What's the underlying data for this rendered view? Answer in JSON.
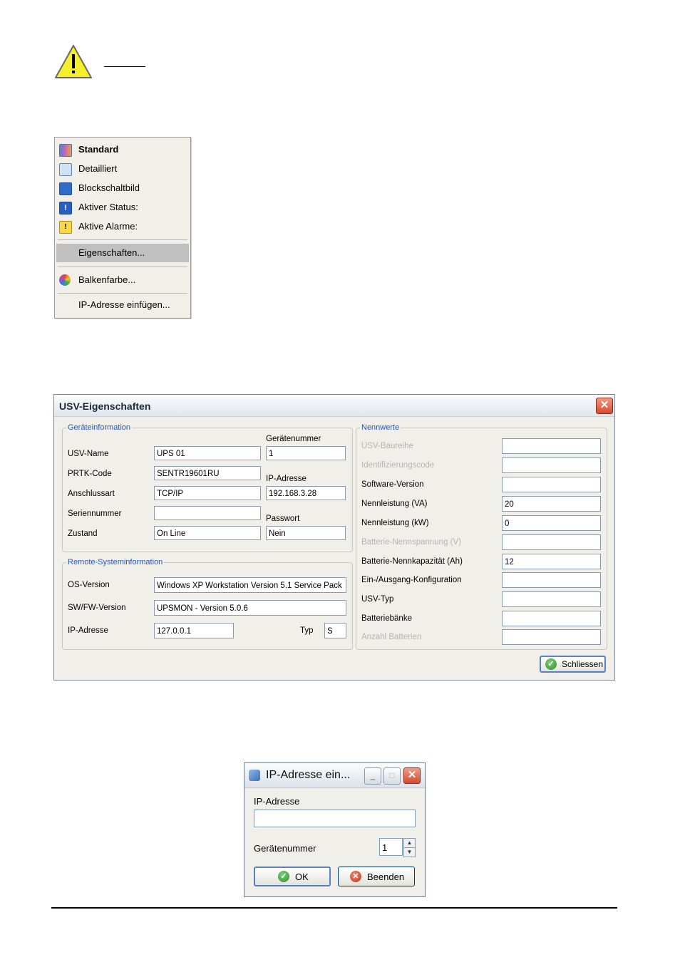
{
  "context_menu": {
    "items": [
      {
        "label": "Standard",
        "icon": "standard-view-icon"
      },
      {
        "label": "Detailliert",
        "icon": "magnifier-icon"
      },
      {
        "label": "Blockschaltbild",
        "icon": "block-diagram-icon"
      },
      {
        "label": "Aktiver Status:",
        "icon": "info-icon"
      },
      {
        "label": "Aktive Alarme:",
        "icon": "warning-icon"
      },
      {
        "label": "Eigenschaften..."
      },
      {
        "label": "Balkenfarbe...",
        "icon": "color-palette-icon"
      },
      {
        "label": "IP-Adresse einfügen..."
      }
    ],
    "selected": "Eigenschaften..."
  },
  "props_dialog": {
    "title": "USV-Eigenschaften",
    "device_group": {
      "title": "Geräteinformation",
      "usv_name_label": "USV-Name",
      "usv_name_value": "UPS 01",
      "prtk_label": "PRTK-Code",
      "prtk_value": "SENTR19601RU",
      "connection_label": "Anschlussart",
      "connection_value": "TCP/IP",
      "serial_label": "Seriennummer",
      "serial_value": "",
      "state_label": "Zustand",
      "state_value": "On Line",
      "device_no_label": "Gerätenummer",
      "device_no_value": "1",
      "ip_label": "IP-Adresse",
      "ip_value": "192.168.3.28",
      "password_label": "Passwort",
      "password_value": "Nein"
    },
    "remote_group": {
      "title": "Remote-Systeminformation",
      "os_label": "OS-Version",
      "os_value": "Windows XP Workstation Version 5.1 Service Pack",
      "fw_label": "SW/FW-Version",
      "fw_value": "UPSMON - Version 5.0.6",
      "ip_label": "IP-Adresse",
      "ip_value": "127.0.0.1",
      "type_label": "Typ",
      "type_value": "S"
    },
    "rating_group": {
      "title": "Nennwerte",
      "rows": [
        {
          "label": "USV-Baureihe",
          "value": "",
          "disabled": true
        },
        {
          "label": "Identifizierungscode",
          "value": "",
          "disabled": true
        },
        {
          "label": "Software-Version",
          "value": "",
          "disabled": false
        },
        {
          "label": "Nennleistung (VA)",
          "value": "20",
          "disabled": false
        },
        {
          "label": "Nennleistung (kW)",
          "value": "0",
          "disabled": false
        },
        {
          "label": "Batterie-Nennspannung (V)",
          "value": "",
          "disabled": true
        },
        {
          "label": "Batterie-Nennkapazität (Ah)",
          "value": "12",
          "disabled": false
        },
        {
          "label": "Ein-/Ausgang-Konfiguration",
          "value": "",
          "disabled": false
        },
        {
          "label": "USV-Typ",
          "value": "",
          "disabled": false
        },
        {
          "label": "Batteriebänke",
          "value": "",
          "disabled": false
        },
        {
          "label": "Anzahl Batterien",
          "value": "",
          "disabled": true
        }
      ]
    },
    "close_label": "Schliessen"
  },
  "ip_dialog": {
    "title": "IP-Adresse ein...",
    "ip_label": "IP-Adresse",
    "ip_value": "",
    "device_no_label": "Gerätenummer",
    "device_no_value": "1",
    "ok_label": "OK",
    "cancel_label": "Beenden"
  },
  "colors": {
    "group_title": "#2a55b7",
    "selection": "#c0c0c0",
    "close_red": "#d34a30"
  }
}
